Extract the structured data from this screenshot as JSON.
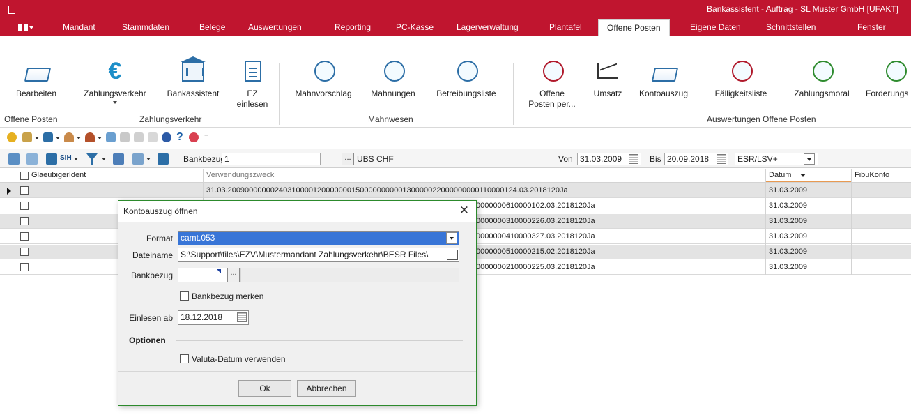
{
  "window": {
    "title": "Bankassistent - Auftrag - SL Muster GmbH [UFAKT]"
  },
  "menu": {
    "tabs": [
      "Mandant",
      "Stammdaten",
      "Belege",
      "Auswertungen",
      "Reporting",
      "PC-Kasse",
      "Lagerverwaltung",
      "Plantafel",
      "Offene Posten",
      "Eigene Daten",
      "Schnittstellen",
      "Fenster"
    ],
    "active_tab": "Offene Posten"
  },
  "ribbon": {
    "buttons": {
      "bearbeiten": "Bearbeiten",
      "zahlungsverkehr": "Zahlungsverkehr",
      "bankassistent": "Bankassistent",
      "ez_einlesen_1": "EZ",
      "ez_einlesen_2": "einlesen",
      "mahnvorschlag": "Mahnvorschlag",
      "mahnungen": "Mahnungen",
      "betreibungsliste": "Betreibungsliste",
      "offene_posten_1": "Offene",
      "offene_posten_2": "Posten per...",
      "umsatz": "Umsatz",
      "kontoauszug": "Kontoauszug",
      "faelligkeitsliste": "Fälligkeitsliste",
      "zahlungsmoral": "Zahlungsmoral",
      "forderungs": "Forderungs"
    },
    "groups": {
      "offene_posten": "Offene Posten",
      "zahlungsverkehr": "Zahlungsverkehr",
      "mahnwesen": "Mahnwesen",
      "auswertungen": "Auswertungen Offene Posten"
    }
  },
  "filterbar": {
    "bankbezug_label": "Bankbezug",
    "bankbezug_value": "1",
    "bank_name": "UBS CHF",
    "von_label": "Von",
    "von_value": "31.03.2009",
    "bis_label": "Bis",
    "bis_value": "20.09.2018",
    "type_value": "ESR/LSV+",
    "sih_label": "SIH"
  },
  "grid": {
    "columns": {
      "glaeubiger": "GlaeubigerIdent",
      "verwendung": "Verwendungszweck",
      "datum": "Datum",
      "fibukonto": "FibuKonto"
    },
    "rows": [
      {
        "verwendung": "31.03.20090000000240310000120000000150000000000130000022000000000110000124.03.2018120Ja",
        "datum": "31.03.2009"
      },
      {
        "verwendung": "0000000610000102.03.2018120Ja",
        "datum": "31.03.2009"
      },
      {
        "verwendung": "0000000310000226.03.2018120Ja",
        "datum": "31.03.2009"
      },
      {
        "verwendung": "0000000410000327.03.2018120Ja",
        "datum": "31.03.2009"
      },
      {
        "verwendung": "0000000510000215.02.2018120Ja",
        "datum": "31.03.2009"
      },
      {
        "verwendung": "0000000210000225.03.2018120Ja",
        "datum": "31.03.2009"
      }
    ]
  },
  "dialog": {
    "title": "Kontoauszug öffnen",
    "close": "✕",
    "format_label": "Format",
    "format_value": "camt.053",
    "dateiname_label": "Dateiname",
    "dateiname_value": "S:\\Support\\files\\EZV\\Mustermandant Zahlungsverkehr\\BESR Files\\",
    "bankbezug_label": "Bankbezug",
    "bankbezug_merken": "Bankbezug merken",
    "einlesen_label": "Einlesen ab",
    "einlesen_value": "18.12.2018",
    "optionen": "Optionen",
    "valuta": "Valuta-Datum verwenden",
    "ok": "Ok",
    "abbrechen": "Abbrechen",
    "ellipsis": "..."
  }
}
